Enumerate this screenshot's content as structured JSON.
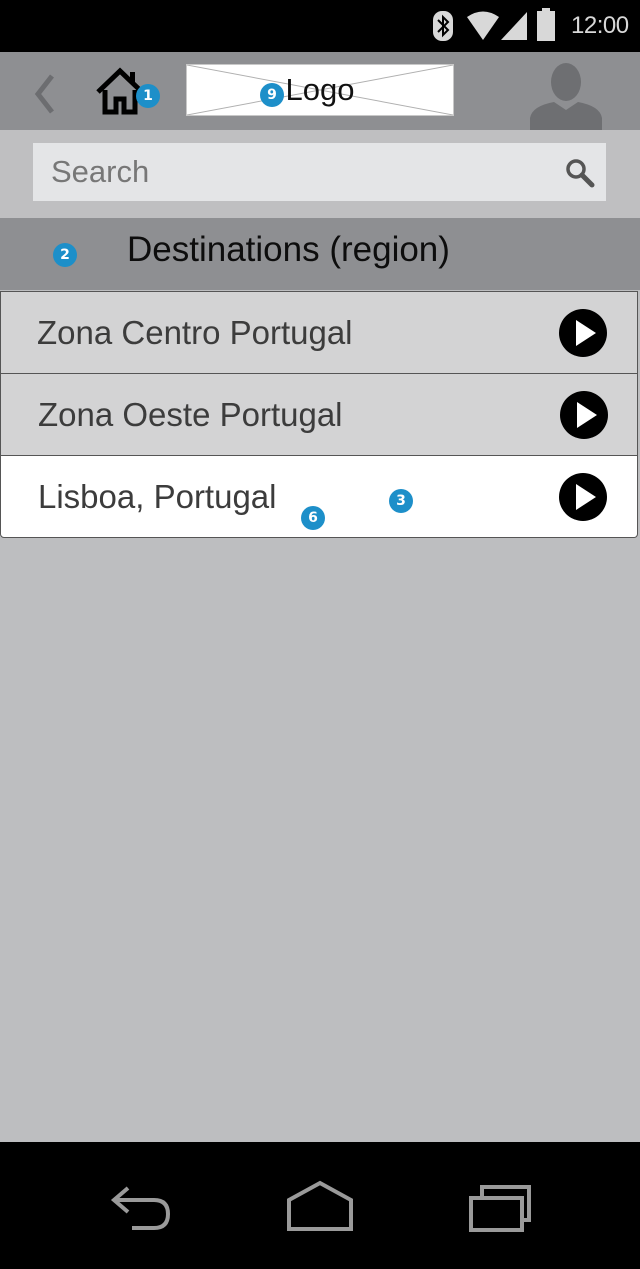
{
  "status_bar": {
    "time": "12:00"
  },
  "header": {
    "logo_text": "Logo",
    "home_badge": "1",
    "logo_badge": "9"
  },
  "search": {
    "placeholder": "Search"
  },
  "section": {
    "title": "Destinations (region)",
    "badge": "2"
  },
  "list": {
    "items": [
      {
        "label": "Zona Centro Portugal"
      },
      {
        "label": "Zona Oeste Portugal"
      },
      {
        "label": "Lisboa, Portugal",
        "badge_a": "6",
        "badge_b": "3"
      }
    ]
  },
  "colors": {
    "accent_badge": "#1d8fc9",
    "app_bar": "#8e8f92",
    "background": "#bdbec0"
  },
  "icons": [
    "bluetooth-icon",
    "wifi-icon",
    "signal-icon",
    "battery-icon",
    "back-chevron-icon",
    "home-icon",
    "avatar-icon",
    "search-icon",
    "play-icon",
    "nav-back-icon",
    "nav-home-icon",
    "nav-recents-icon"
  ]
}
